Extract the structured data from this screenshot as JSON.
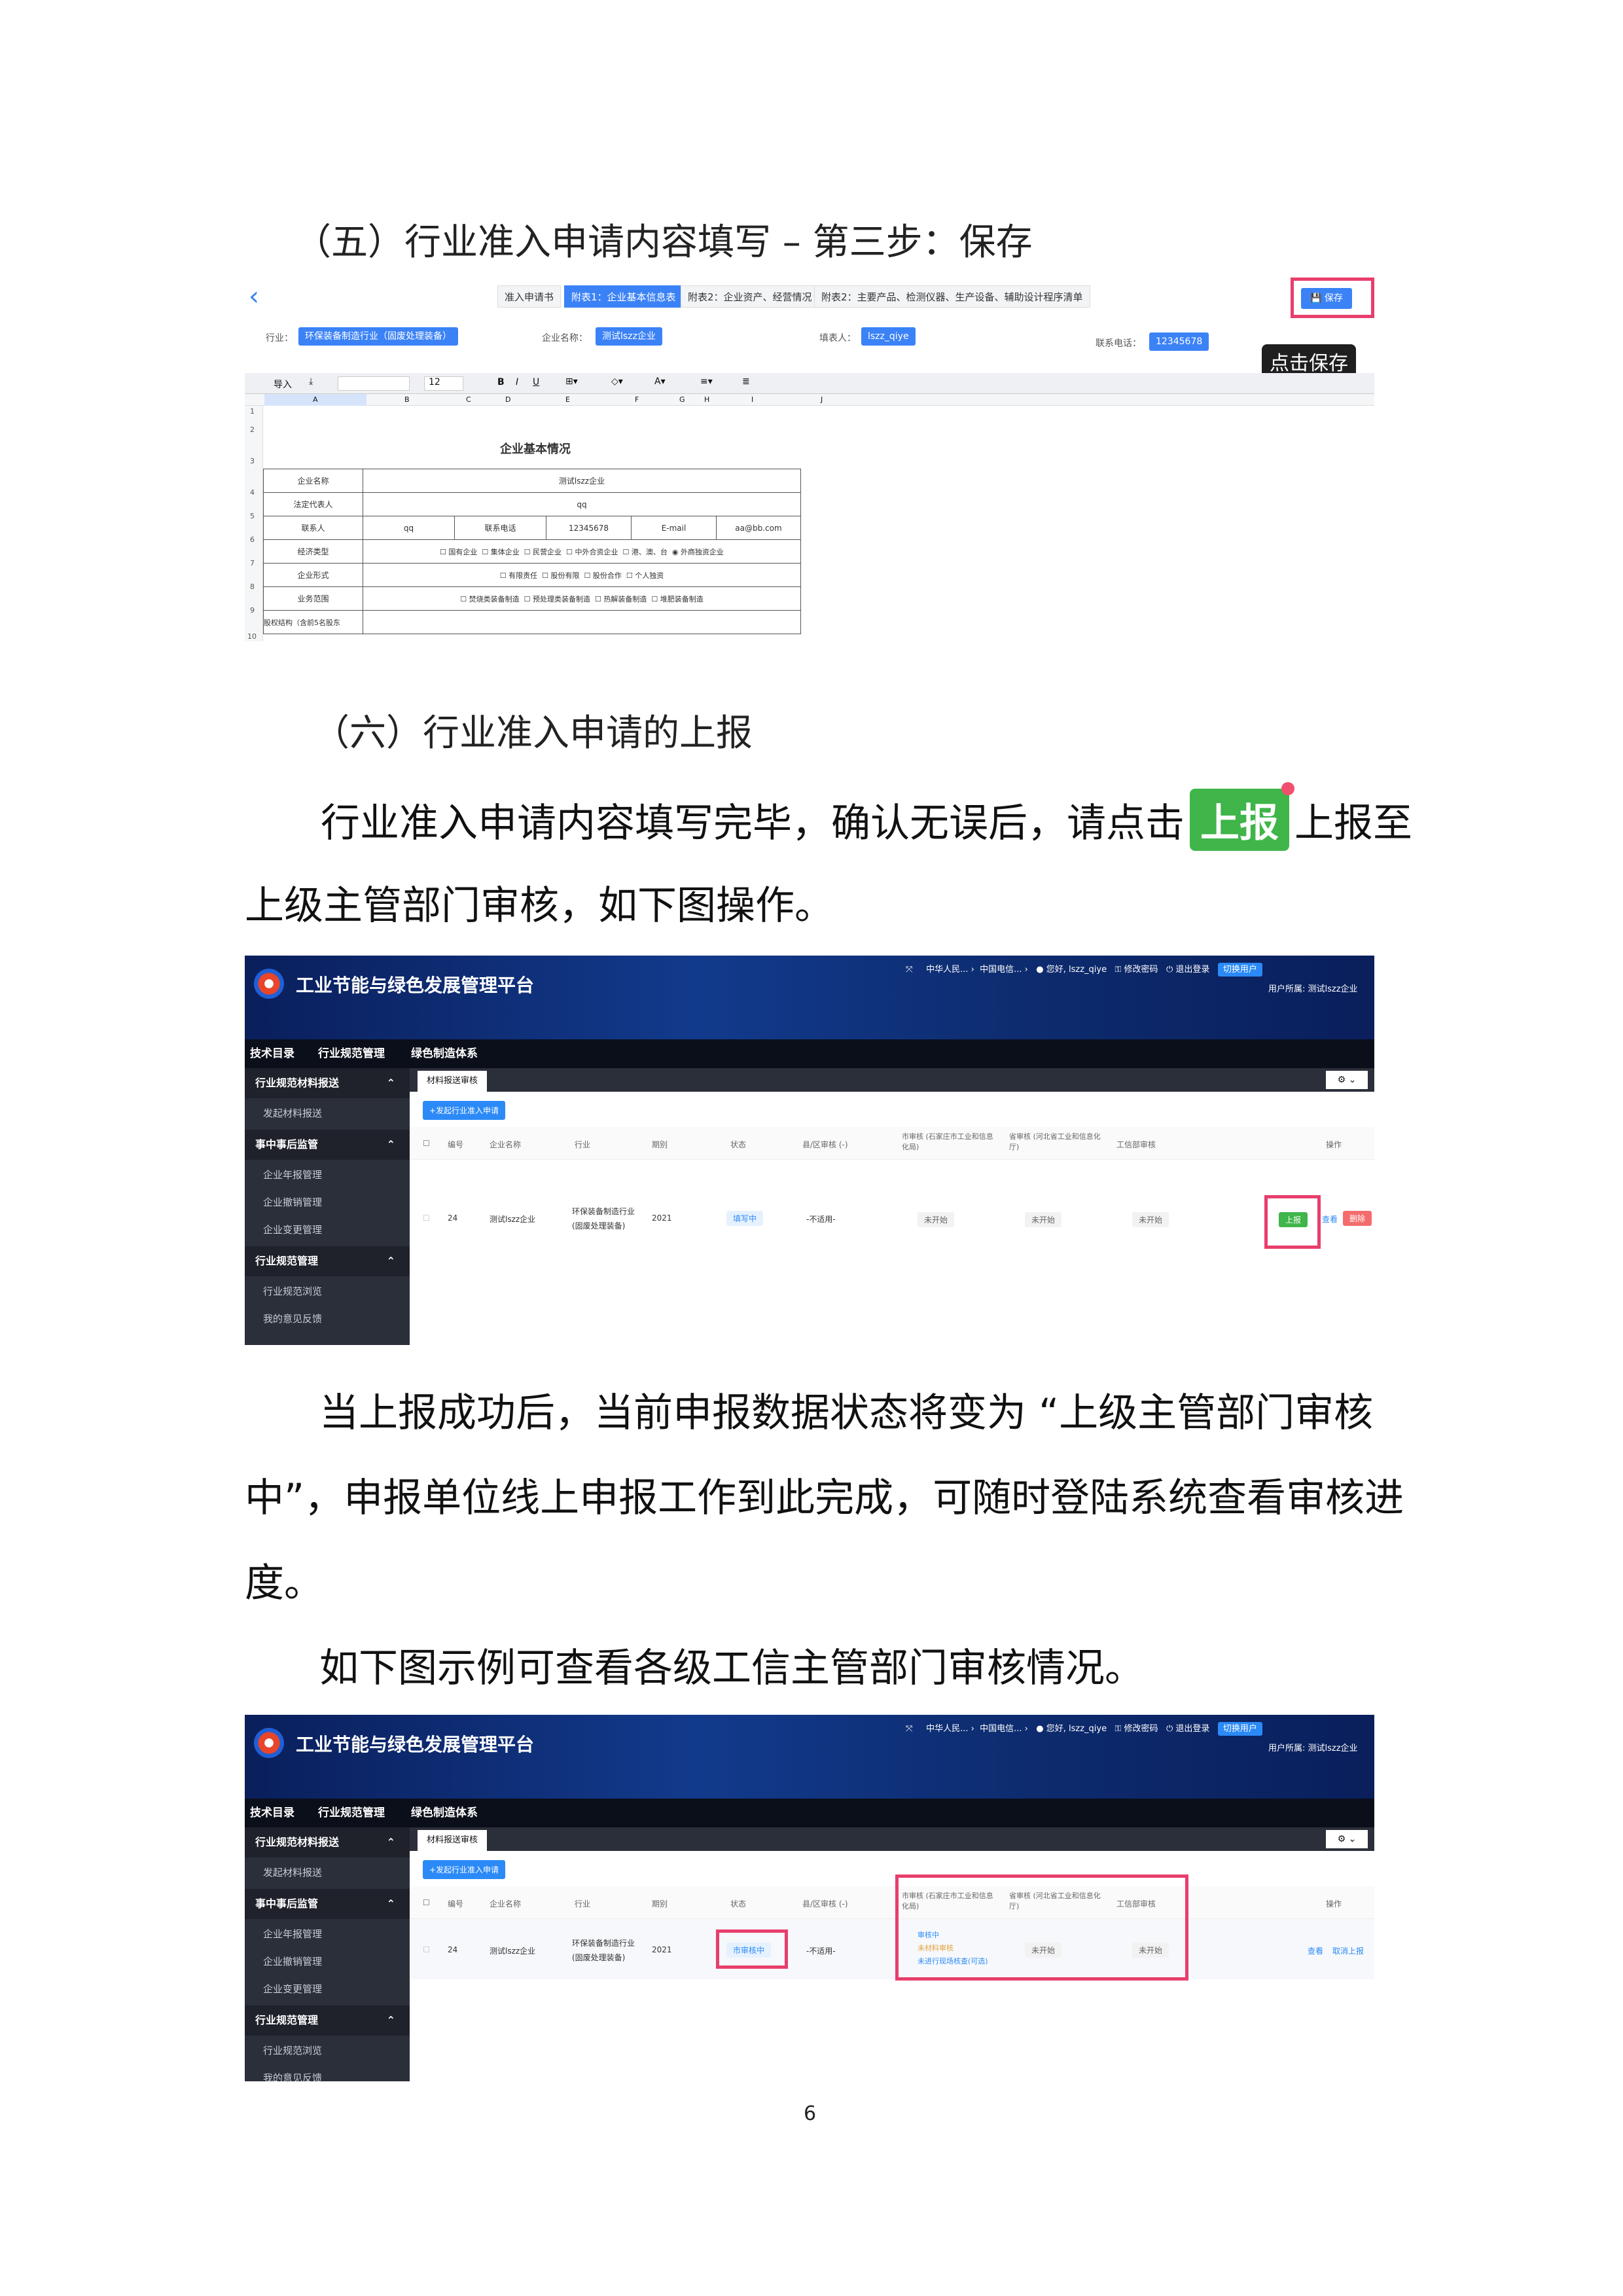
{
  "headings": {
    "five": "（五）行业准入申请内容填写 – 第三步：保存",
    "six": "（六）行业准入申请的上报"
  },
  "para1": {
    "line1a": "行业准入申请内容填写完毕，确认无误后，请点击",
    "inline_button": "上报",
    "line1b": "上报至",
    "line2": "上级主管部门审核，如下图操作。"
  },
  "para2": {
    "line1": "当上报成功后，当前申报数据状态将变为 “上级主管部门审核",
    "line2": "中”，申报单位线上申报工作到此完成，可随时登陆系统查看审核进",
    "line3": "度。"
  },
  "para3": "如下图示例可查看各级工信主管部门审核情况。",
  "page_number": "6",
  "shot1": {
    "back": "‹",
    "tabs": [
      "准入申请书",
      "附表1：企业基本信息表",
      "附表2：企业资产、经营情况",
      "附表2：主要产品、检测仪器、生产设备、辅助设计程序清单"
    ],
    "save": "保存",
    "tooltip": "点击保存",
    "industry_label": "行业：",
    "industry": "环保装备制造行业（固废处理装备）",
    "company_label": "企业名称：",
    "company": "测试lszz企业",
    "filler_label": "填表人：",
    "filler": "lszz_qiye",
    "phone_label": "联系电话：",
    "phone": "12345678",
    "toolbar": {
      "import": "导入",
      "font_size": "12"
    },
    "cols": [
      "A",
      "B",
      "C",
      "D",
      "E",
      "F",
      "G",
      "H",
      "I",
      "J"
    ],
    "rows": [
      "1",
      "2",
      "3",
      "4",
      "5",
      "6",
      "7",
      "8",
      "9",
      "10"
    ],
    "sheet_title": "企业基本情况",
    "cells": {
      "name_l": "企业名称",
      "name_v": "测试lszz企业",
      "legal_l": "法定代表人",
      "legal_v": "qq",
      "contact_l": "联系人",
      "contact_v": "qq",
      "tel_l": "联系电话",
      "tel_v": "12345678",
      "email_l": "E-mail",
      "email_v": "aa@bb.com",
      "econ_l": "经济类型",
      "form_l": "企业形式",
      "scope_l": "业务范围",
      "equity_l": "股权结构（含前5名股东"
    },
    "econ_opts": [
      "国有企业",
      "集体企业",
      "民营企业",
      "中外合资企业",
      "港、澳、台",
      "外商独资企业"
    ],
    "form_opts": [
      "有限责任",
      "股份有限",
      "股份合作",
      "个人独资"
    ],
    "scope_opts": [
      "焚烧类装备制造",
      "预处理类装备制造",
      "热解装备制造",
      "堆肥装备制造"
    ]
  },
  "app": {
    "title": "工业节能与绿色发展管理平台",
    "top": {
      "a": "中华人民...",
      "b": "中国电信...",
      "user": "您好, lszz_qiye",
      "pwd": "修改密码",
      "logout": "退出登录",
      "switch": "切换用户",
      "owner": "用户所属: 测试lszz企业"
    },
    "nav": [
      "技术目录",
      "行业规范管理",
      "绿色制造体系"
    ],
    "side": {
      "g1": "行业规范材料报送",
      "g1a": "发起材料报送",
      "g2": "事中事后监管",
      "g2a": "企业年报管理",
      "g2b": "企业撤销管理",
      "g2c": "企业变更管理",
      "g3": "行业规范管理",
      "g3a": "行业规范浏览",
      "g3b": "我的意见反馈"
    },
    "tab": "材料报送审核",
    "btn_new": "+发起行业准入申请",
    "head": {
      "no": "编号",
      "name": "企业名称",
      "ind": "行业",
      "period": "期别",
      "status": "状态",
      "county": "县/区审核 (-)",
      "city": "市审核 (石家庄市工业和信息化局)",
      "city2": "信化局)",
      "prov": "省审核 (河北省工业和信息化厅)",
      "prov2": "息化厅)",
      "miit": "工信部审核",
      "op": "操作"
    },
    "row": {
      "no": "24",
      "name": "测试lszz企业",
      "ind1": "环保装备制造行业",
      "ind2": "(固废处理装备)",
      "period": "2021",
      "county": "-不适用-",
      "notstart": "未开始"
    },
    "row1": {
      "status": "填写中",
      "report": "上报",
      "view": "查看",
      "del": "删除"
    },
    "row2": {
      "status": "市审核中",
      "c1": "审核中",
      "c2": "未材料审核",
      "c3": "未进行现场核查(可选)",
      "view": "查看",
      "cancel": "取消上报"
    }
  }
}
